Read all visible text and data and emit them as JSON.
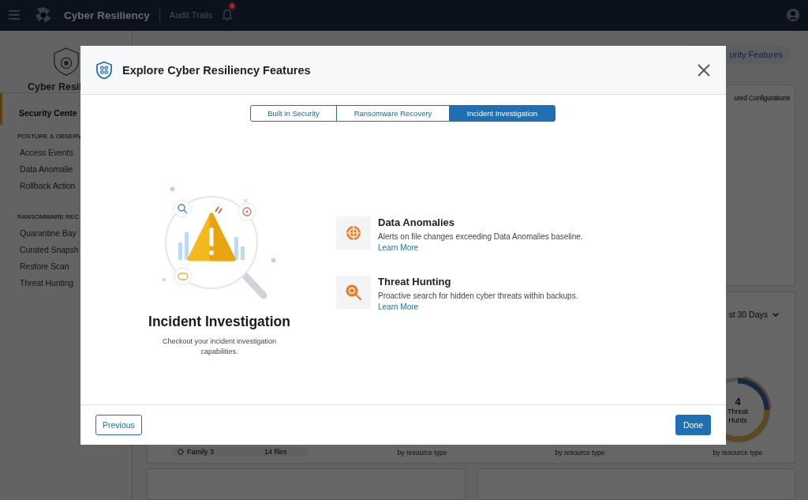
{
  "header": {
    "title": "Cyber Resiliency",
    "link": "Audit Trails",
    "notification_count": "8"
  },
  "sidebar": {
    "title": "Cyber Resil",
    "nav": [
      {
        "label": "Security Cente",
        "selected": true
      }
    ],
    "sections": [
      {
        "heading": "POSTURE & OBSERV",
        "items": [
          {
            "label": "Access Events",
            "selected": false
          },
          {
            "label": "Data Anomalie",
            "selected": false
          },
          {
            "label": "Rollback Action",
            "selected": false
          }
        ]
      },
      {
        "heading": "RANSOMWARE REC",
        "items": [
          {
            "label": "Quarantine Bay",
            "selected": false
          },
          {
            "label": "Curated Snapsh",
            "selected": false
          },
          {
            "label": "Restore Scan",
            "selected": false
          },
          {
            "label": "Threat Hunting",
            "selected": false
          }
        ]
      }
    ]
  },
  "main": {
    "features_button": "urity Features",
    "card_1": {
      "label": "ured Configurations"
    },
    "card_2": {
      "range": "st 30 Days",
      "table_row": {
        "name": "Family 3",
        "count": "14 files"
      },
      "captions": [
        "by resource type",
        "by resource type",
        "by resource type"
      ],
      "donut": {
        "value": "4",
        "label": "Threat Hunts"
      }
    }
  },
  "modal": {
    "title": "Explore Cyber Resiliency Features",
    "tabs": [
      {
        "label": "Built in Security",
        "selected": false
      },
      {
        "label": "Ransomware Recovery",
        "selected": false
      },
      {
        "label": "Incident Investigation",
        "selected": true
      }
    ],
    "heading": "Incident Investigation",
    "description": "Checkout your incident investigation capabilities.",
    "features": [
      {
        "kind": "anomaly",
        "title": "Data Anomalies",
        "description": "Alerts on file changes exceeding Data Anomalies baseline.",
        "link": "Learn More"
      },
      {
        "kind": "hunt",
        "title": "Threat Hunting",
        "description": "Proactive search for hidden cyber threats within backups.",
        "link": "Learn More"
      }
    ],
    "previous": "Previous",
    "done": "Done"
  }
}
